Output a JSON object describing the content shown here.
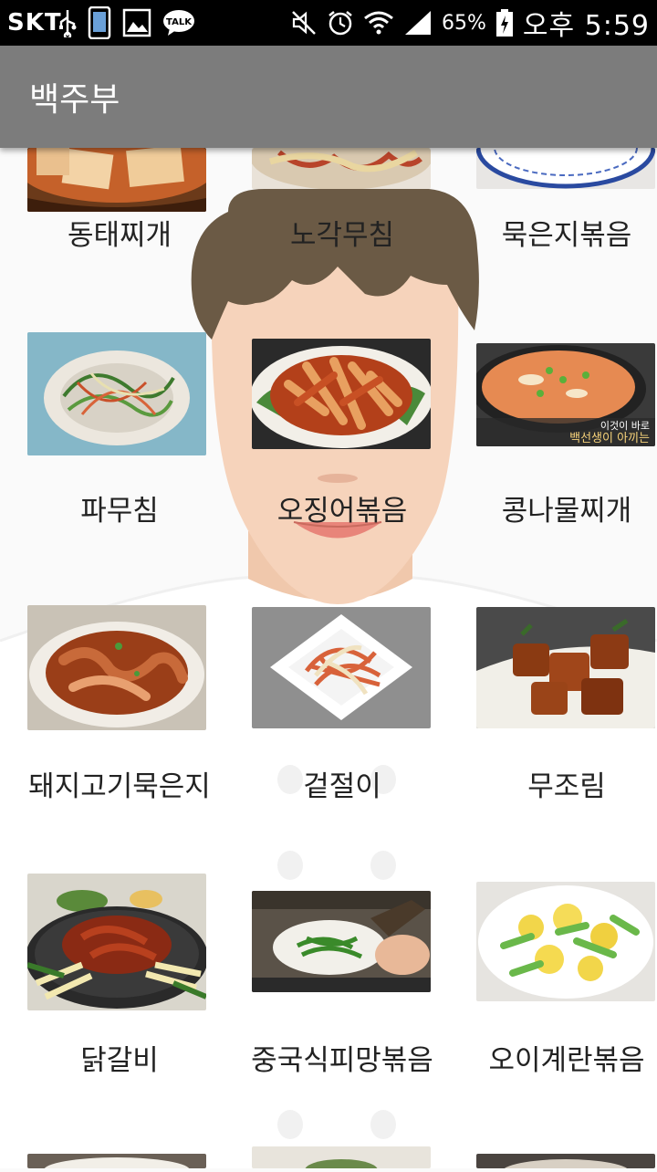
{
  "status_bar": {
    "carrier": "SKT",
    "battery": "65%",
    "time": "오후 5:59",
    "left_icons": [
      "usb-icon",
      "phone-icon",
      "gallery-icon",
      "talk-icon"
    ],
    "talk_label": "TALK",
    "right_icons": [
      "mute-icon",
      "alarm-icon",
      "wifi-icon",
      "signal-icon",
      "battery-icon"
    ]
  },
  "app_bar": {
    "title": "백주부",
    "color": "#7c7c7c"
  },
  "recipes": [
    {
      "name": "동태찌개",
      "icon": "stew-thumbnail"
    },
    {
      "name": "노각무침",
      "icon": "salad-thumbnail"
    },
    {
      "name": "묵은지볶음",
      "icon": "plate-thumbnail"
    },
    {
      "name": "파무침",
      "icon": "green-onion-salad-thumbnail"
    },
    {
      "name": "오징어볶음",
      "icon": "squid-stirfry-thumbnail"
    },
    {
      "name": "콩나물찌개",
      "icon": "bean-sprout-stew-thumbnail"
    },
    {
      "name": "돼지고기묵은지",
      "icon": "pork-kimchi-thumbnail"
    },
    {
      "name": "겉절이",
      "icon": "fresh-kimchi-thumbnail"
    },
    {
      "name": "무조림",
      "icon": "braised-radish-thumbnail"
    },
    {
      "name": "닭갈비",
      "icon": "dakgalbi-thumbnail"
    },
    {
      "name": "중국식피망볶음",
      "icon": "pepper-stirfry-thumbnail"
    },
    {
      "name": "오이계란볶음",
      "icon": "cucumber-egg-thumbnail"
    }
  ],
  "thumbnail_text": {
    "bean_sprout_stew_caption_1": "이것이 바로",
    "bean_sprout_stew_caption_2": "백선생이 아끼는"
  }
}
